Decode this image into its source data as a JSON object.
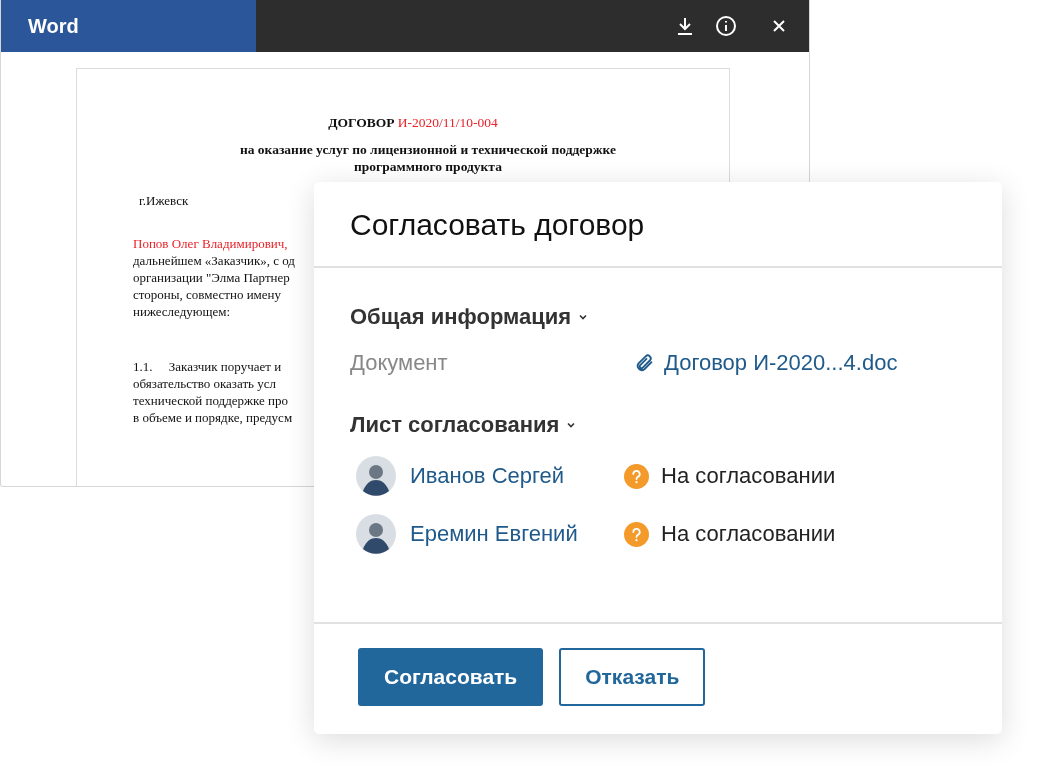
{
  "viewer": {
    "title": "Word"
  },
  "document": {
    "heading_label": "ДОГОВОР",
    "heading_number": "И-2020/11/10-004",
    "subtitle": [
      "на оказание услуг по лицензионной и технической поддержке",
      "программного продукта"
    ],
    "city": "г.Ижевск",
    "paragraphs": [
      {
        "lines": [
          {
            "text": "Попов Олег Владимирович,",
            "highlighted": true
          },
          {
            "text": "дальнейшем «Заказчик», с од",
            "highlighted": false
          },
          {
            "text": "организации \"Элма Партнер",
            "highlighted": false
          },
          {
            "text": "стороны, совместно имену",
            "highlighted": false
          },
          {
            "text": "нижеследующем:",
            "highlighted": false
          }
        ]
      },
      {
        "lines": [
          {
            "text": "1.1.     Заказчик поручает и",
            "highlighted": false
          },
          {
            "text": "обязательство оказать усл",
            "highlighted": false
          },
          {
            "text": "технической поддержке про",
            "highlighted": false
          },
          {
            "text": "в объеме и порядке, предусм",
            "highlighted": false
          }
        ]
      }
    ]
  },
  "dialog": {
    "title": "Согласовать договор",
    "sections": [
      {
        "kind": "fields",
        "title": "Общая информация",
        "expanded": true,
        "fields": [
          {
            "label": "Документ",
            "value": "Договор И-2020...4.doc"
          }
        ]
      },
      {
        "kind": "approvers",
        "title": "Лист согласования",
        "expanded": true,
        "approvers": [
          {
            "name": "Иванов Сергей",
            "status": "На согласовании"
          },
          {
            "name": "Еремин Евгений",
            "status": "На согласовании"
          }
        ]
      }
    ],
    "buttons": [
      {
        "label": "Согласовать",
        "kind": "primary"
      },
      {
        "label": "Отказать",
        "kind": "secondary"
      }
    ]
  }
}
